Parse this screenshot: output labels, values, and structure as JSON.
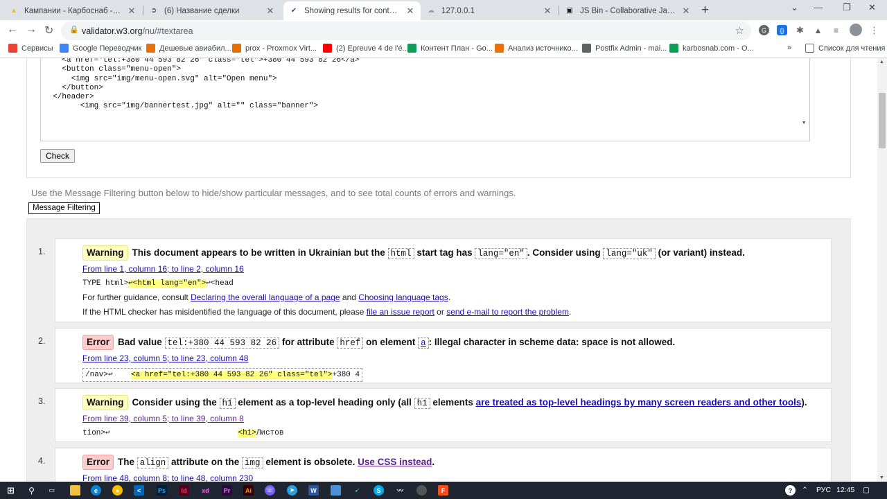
{
  "tabs": [
    {
      "title": "Кампании - Карбоснаб - Google",
      "icon": "google-ads-icon",
      "color": "#fbbc04",
      "active": false
    },
    {
      "title": "(6) Название сделки",
      "icon": "arrow-circle-icon",
      "color": "#3c4043",
      "active": false
    },
    {
      "title": "Showing results for contents of t",
      "icon": "w3c-validator-icon",
      "color": "#5b3b8c",
      "active": true
    },
    {
      "title": "127.0.0.1",
      "icon": "cloud-icon",
      "color": "#9aa0a6",
      "active": false
    },
    {
      "title": "JS Bin - Collaborative JavaScript D",
      "icon": "jsbin-icon",
      "color": "#1a1a1a",
      "active": false
    }
  ],
  "toolbar": {
    "url_host": "validator.w3.org",
    "url_path": "/nu/#textarea"
  },
  "bookmarks": [
    {
      "label": "Сервисы",
      "icon": "apps-grid-icon",
      "color": "#ea4335"
    },
    {
      "label": "Google Переводчик",
      "icon": "google-translate-icon",
      "color": "#4285f4"
    },
    {
      "label": "Дешевые авиабил...",
      "icon": "aviasales-icon",
      "color": "#e8710a"
    },
    {
      "label": "prox - Proxmox Virt...",
      "icon": "proxmox-icon",
      "color": "#e57000"
    },
    {
      "label": "(2) Epreuve 4 de l'é...",
      "icon": "youtube-icon",
      "color": "#ff0000"
    },
    {
      "label": "Контент План - Go...",
      "icon": "google-sheets-icon",
      "color": "#0f9d58"
    },
    {
      "label": "Анализ источнико...",
      "icon": "w-icon",
      "color": "#e8710a"
    },
    {
      "label": "Postfix Admin - mai...",
      "icon": "globe-icon",
      "color": "#5f6368"
    },
    {
      "label": "karbosnab.com - О...",
      "icon": "google-sheets-icon",
      "color": "#0f9d58"
    }
  ],
  "reading_list": "Список для чтения",
  "code_lines": [
    "    <a href=\"tel:+380 44 593 82 26\" class=\"tel\">+380 44 593 82 26</a>",
    "    <button class=\"menu-open\">",
    "      <img src=\"img/menu-open.svg\" alt=\"Open menu\">",
    "    </button>",
    "  </header>",
    "        <img src=\"img/bannertest.jpg\" alt=\"\" class=\"banner\">"
  ],
  "check_label": "Check",
  "filter_text": "Use the Message Filtering button below to hide/show particular messages, and to see total counts of errors and warnings.",
  "filter_button": "Message Filtering",
  "messages": [
    {
      "num": "1.",
      "type": "Warning",
      "head": [
        {
          "t": "This document appears to be written in Ukrainian but the "
        },
        {
          "c": "html"
        },
        {
          "t": " start tag has "
        },
        {
          "c": "lang=\"en\""
        },
        {
          "t": ". Consider using "
        },
        {
          "c": "lang=\"uk\""
        },
        {
          "t": " (or variant) instead."
        }
      ],
      "location": "From line 1, column 16; to line 2, column 16",
      "extract_pre": "TYPE html>",
      "extract_hl": "↩<html lang=\"en\">",
      "extract_post": "↩<head",
      "guidance_pre": "For further guidance, consult ",
      "guidance_link1": "Declaring the overall language of a page",
      "guidance_and": " and ",
      "guidance_link2": "Choosing language tags",
      "guidance_end": ".",
      "misid_pre": "If the HTML checker has misidentified the language of this document, please ",
      "misid_link1": "file an issue report",
      "misid_or": " or ",
      "misid_link2": "send e-mail to report the problem",
      "misid_end": "."
    },
    {
      "num": "2.",
      "type": "Error",
      "head": [
        {
          "t": "Bad value "
        },
        {
          "c": "tel:+380 44 593 82 26"
        },
        {
          "t": " for attribute "
        },
        {
          "c": "href"
        },
        {
          "t": " on element "
        },
        {
          "c": "a",
          "link": true
        },
        {
          "t": ": Illegal character in scheme data: space is not allowed."
        }
      ],
      "location": "From line 23, column 5; to line 23, column 48",
      "extract_pre": "/nav>↩    ",
      "extract_hl": "<a href=\"tel:+380 44 593 82 26\" class=\"tel\">",
      "extract_post": "+380 4"
    },
    {
      "num": "3.",
      "type": "Warning",
      "head": [
        {
          "t": "Consider using the "
        },
        {
          "c": "h1"
        },
        {
          "t": " element as a top-level heading only (all "
        },
        {
          "c": "h1"
        },
        {
          "t": " elements "
        },
        {
          "a": "are treated as top-level headings by many screen readers and other tools"
        },
        {
          "t": ")."
        }
      ],
      "location": "From line 39, column 5; to line 39, column 8",
      "extract_pre": "tion>↩                            ",
      "extract_hl": "<h1>",
      "extract_post": "Листов"
    },
    {
      "num": "4.",
      "type": "Error",
      "head": [
        {
          "t": "The "
        },
        {
          "c": "align"
        },
        {
          "t": " attribute on the "
        },
        {
          "c": "img"
        },
        {
          "t": " element is obsolete. "
        },
        {
          "a": "Use CSS instead",
          "visited": true
        },
        {
          "t": "."
        }
      ],
      "location": "From line 48, column 8; to line 48, column 230"
    }
  ],
  "taskbar": {
    "lang": "РУС",
    "time": "12:45"
  }
}
